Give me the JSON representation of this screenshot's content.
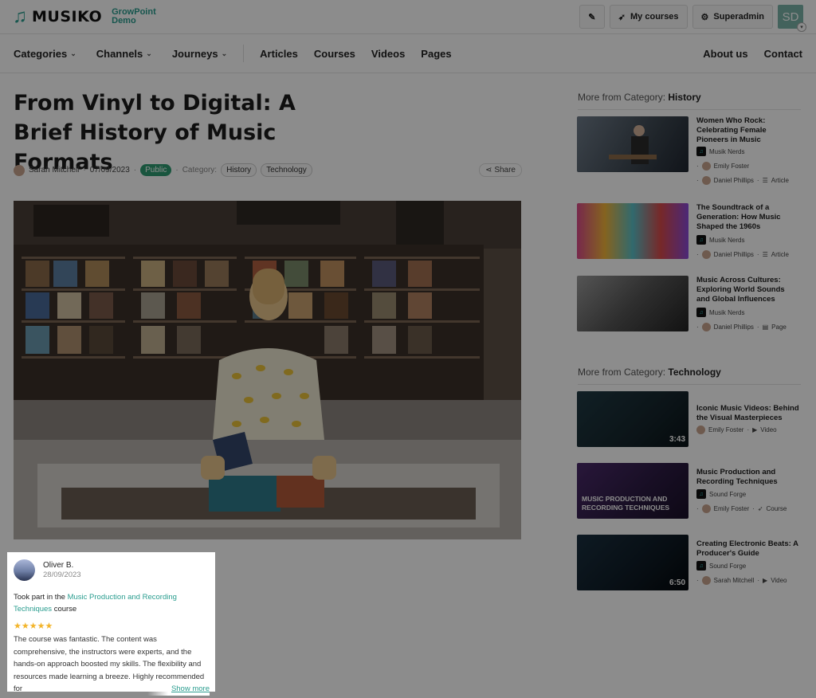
{
  "brand": {
    "name": "MUSIKO",
    "sub1": "GrowPoint",
    "sub2": "Demo"
  },
  "topbar": {
    "my_courses": "My courses",
    "superadmin": "Superadmin",
    "avatar_initials": "SD"
  },
  "nav": {
    "dropdowns": [
      "Categories",
      "Channels",
      "Journeys"
    ],
    "links": [
      "Articles",
      "Courses",
      "Videos",
      "Pages"
    ],
    "right": [
      "About us",
      "Contact"
    ]
  },
  "article": {
    "title": "From Vinyl to Digital: A Brief History of Music Formats",
    "author": "Sarah Mitchell",
    "date": "07/09/2023",
    "visibility": "Public",
    "category_label": "Category:",
    "tags": [
      "History",
      "Technology"
    ],
    "share": "Share"
  },
  "sidebar": {
    "history": {
      "prefix": "More from Category:",
      "name": "History",
      "items": [
        {
          "title": "Women Who Rock: Celebrating Female Pioneers in Music",
          "channel": "Musik Nerds",
          "line2": "Emily Foster",
          "author": "Daniel Phillips",
          "type": "Article"
        },
        {
          "title": "The Soundtrack of a Generation: How Music Shaped the 1960s",
          "channel": "Musik Nerds",
          "author": "Daniel Phillips",
          "type": "Article"
        },
        {
          "title": "Music Across Cultures: Exploring World Sounds and Global Influences",
          "channel": "Musik Nerds",
          "author": "Daniel Phillips",
          "type": "Page"
        }
      ]
    },
    "technology": {
      "prefix": "More from Category:",
      "name": "Technology",
      "items": [
        {
          "title": "Iconic Music Videos: Behind the Visual Masterpieces",
          "author": "Emily Foster",
          "type": "Video",
          "duration": "3:43"
        },
        {
          "title": "Music Production and Recording Techniques",
          "channel": "Sound Forge",
          "author": "Emily Foster",
          "type": "Course",
          "thumb_text": "MUSIC PRODUCTION AND RECORDING TECHNIQUES"
        },
        {
          "title": "Creating Electronic Beats: A Producer's Guide",
          "channel": "Sound Forge",
          "author": "Sarah Mitchell",
          "type": "Video",
          "duration": "6:50"
        }
      ]
    }
  },
  "review": {
    "name": "Oliver B.",
    "date": "28/09/2023",
    "took_prefix": "Took part in the",
    "course_link": "Music Production and Recording Techniques",
    "took_suffix": "course",
    "stars": "★★★★★",
    "body": "The course was fantastic. The content was comprehensive, the instructors were experts, and the hands-on approach boosted my skills. The flexibility and resources made learning a breeze. Highly recommended for",
    "show_more": "Show more"
  },
  "colors": {
    "accent": "#2a9d8f",
    "public_badge": "#2e9c72",
    "star": "#f3b52c"
  }
}
